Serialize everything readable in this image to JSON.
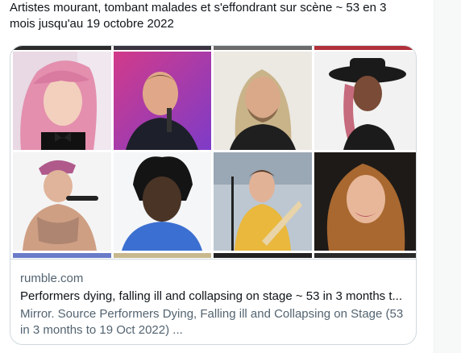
{
  "tweet": {
    "text": "Artistes mourant, tombant malades et s'effondrant sur scène ~ 53 en 3 mois jusqu'au 19 octobre 2022"
  },
  "card": {
    "domain": "rumble.com",
    "title": "Performers dying, falling ill and collapsing on stage ~ 53 in 3 months t...",
    "description": "Mirror. Source Performers Dying, Falling ill and Collapsing on Stage (53 in 3 months to 19 Oct 2022) ..."
  },
  "colors": {
    "text_primary": "#0f1419",
    "text_secondary": "#536471",
    "border": "#cfd9de"
  }
}
